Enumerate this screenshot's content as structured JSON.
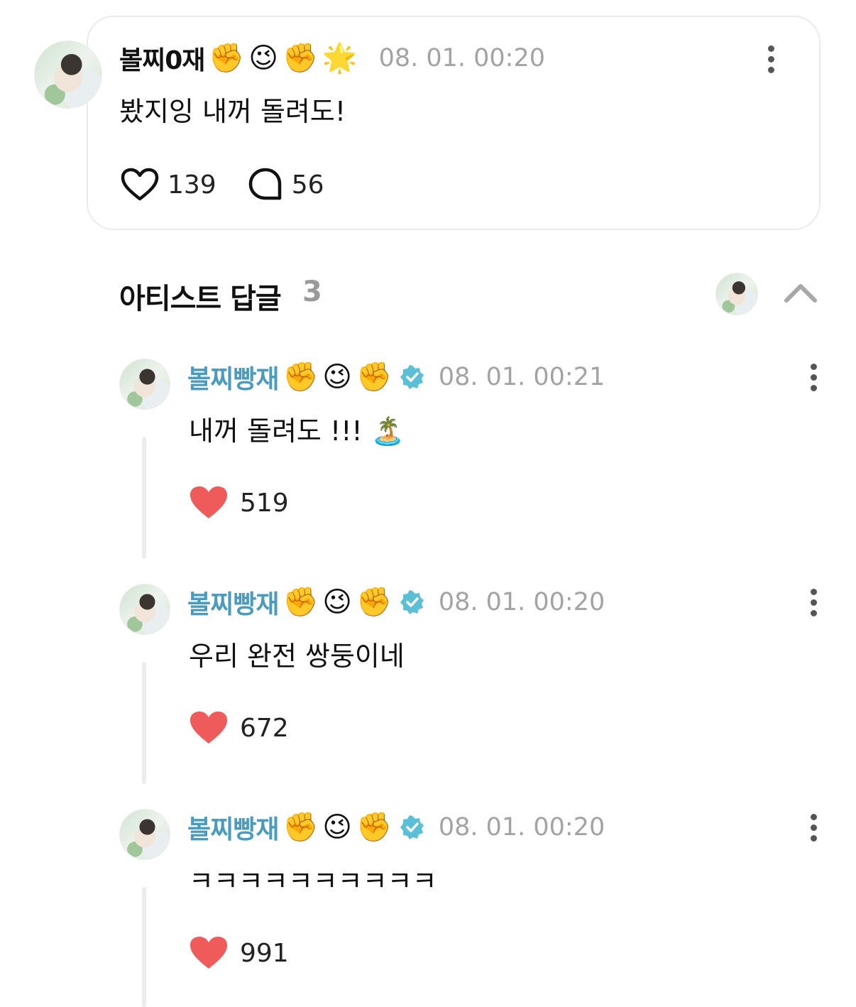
{
  "post": {
    "author": "볼찌0재",
    "author_emojis": [
      "✊",
      "😉",
      "✊",
      "🌟"
    ],
    "timestamp": "08. 01. 00:20",
    "text": "봤지잉 내꺼 돌려도!",
    "likes": "139",
    "comments": "56"
  },
  "artist_replies": {
    "title": "아티스트 답글",
    "count": "3"
  },
  "replies": [
    {
      "author": "볼찌빵재",
      "author_emojis": [
        "✊",
        "😉",
        "✊"
      ],
      "timestamp": "08. 01. 00:21",
      "text": "내꺼 돌려도 !!! 🏝️",
      "likes": "519"
    },
    {
      "author": "볼찌빵재",
      "author_emojis": [
        "✊",
        "😉",
        "✊"
      ],
      "timestamp": "08. 01. 00:20",
      "text": "우리 완전 쌍둥이네",
      "likes": "672"
    },
    {
      "author": "볼찌빵재",
      "author_emojis": [
        "✊",
        "😉",
        "✊"
      ],
      "timestamp": "08. 01. 00:20",
      "text": "ㅋㅋㅋㅋㅋㅋㅋㅋㅋㅋ",
      "likes": "991"
    }
  ],
  "colors": {
    "artist_name": "#4a9cbf",
    "verified_badge": "#5bbfd6",
    "heart_filled": "#ef5a5a",
    "timestamp": "#a3a3a3"
  }
}
